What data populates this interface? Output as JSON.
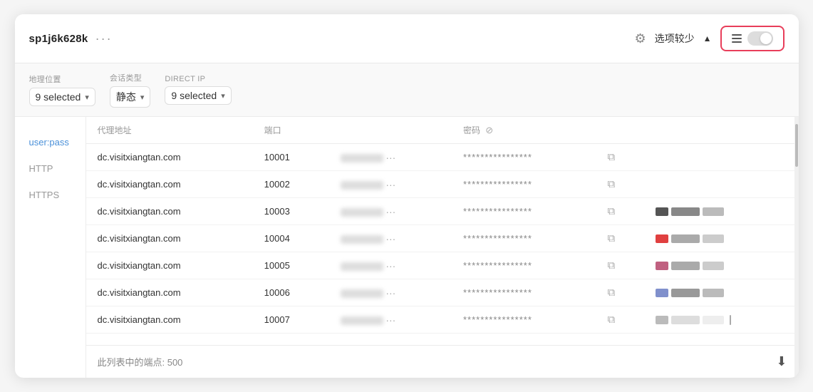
{
  "header": {
    "title": "sp1j6k628k",
    "dots_label": "···",
    "gear_label": "⚙",
    "options_label": "选项较少",
    "chevron_label": "▲"
  },
  "filters": {
    "geo_label": "地理位置",
    "geo_value": "9 selected",
    "session_label": "会话类型",
    "session_value": "静态",
    "direct_ip_label": "DIRECT IP",
    "direct_ip_value": "9 selected"
  },
  "sidebar": {
    "items": [
      {
        "id": "userpass",
        "label": "user:pass",
        "active": true
      },
      {
        "id": "http",
        "label": "HTTP",
        "active": false
      },
      {
        "id": "https",
        "label": "HTTPS",
        "active": false
      }
    ]
  },
  "table": {
    "columns": [
      {
        "id": "proxy",
        "label": "代理地址"
      },
      {
        "id": "port",
        "label": "端口"
      },
      {
        "id": "user",
        "label": ""
      },
      {
        "id": "password",
        "label": "密码"
      },
      {
        "id": "copy",
        "label": ""
      },
      {
        "id": "info",
        "label": ""
      }
    ],
    "rows": [
      {
        "id": 1,
        "proxy": "dc.visitxiangtan.com",
        "port": "10001",
        "password": "****************",
        "has_color": false
      },
      {
        "id": 2,
        "proxy": "dc.visitxiangtan.com",
        "port": "10002",
        "password": "****************",
        "has_color": false
      },
      {
        "id": 3,
        "proxy": "dc.visitxiangtan.com",
        "port": "10003",
        "password": "****************",
        "has_color": true,
        "colors": [
          "#555",
          "#888",
          "#bbb"
        ]
      },
      {
        "id": 4,
        "proxy": "dc.visitxiangtan.com",
        "port": "10004",
        "password": "****************",
        "has_color": true,
        "colors": [
          "#e04040",
          "#aaa",
          "#ccc"
        ]
      },
      {
        "id": 5,
        "proxy": "dc.visitxiangtan.com",
        "port": "10005",
        "password": "****************",
        "has_color": true,
        "colors": [
          "#c06080",
          "#aaa",
          "#ccc"
        ]
      },
      {
        "id": 6,
        "proxy": "dc.visitxiangtan.com",
        "port": "10006",
        "password": "****************",
        "has_color": true,
        "colors": [
          "#8090cc",
          "#999",
          "#bbb"
        ]
      },
      {
        "id": 7,
        "proxy": "dc.visitxiangtan.com",
        "port": "10007",
        "password": "****************",
        "has_color": true,
        "colors": [
          "#bbb",
          "#ddd",
          "#eee"
        ]
      }
    ],
    "footer_text": "此列表中的端点: 500"
  }
}
